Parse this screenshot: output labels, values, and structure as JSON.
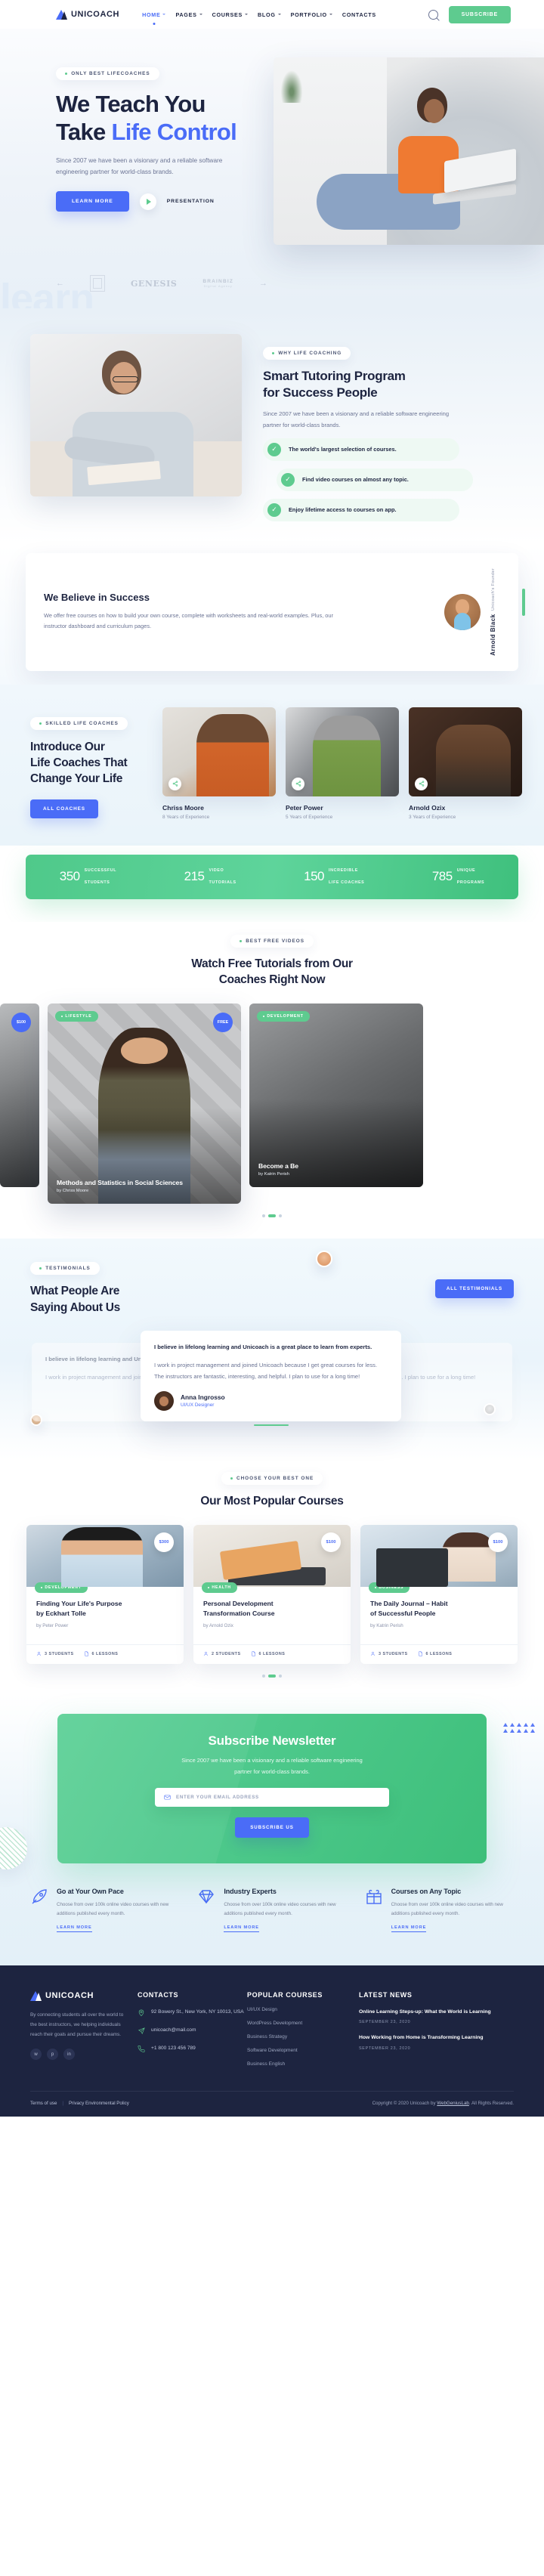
{
  "header": {
    "logo_text": "UNICOACH",
    "nav": [
      {
        "label": "HOME",
        "active": true
      },
      {
        "label": "PAGES",
        "active": false
      },
      {
        "label": "COURSES",
        "active": false
      },
      {
        "label": "BLOG",
        "active": false
      },
      {
        "label": "PORTFOLIO",
        "active": false
      },
      {
        "label": "CONTACTS",
        "active": false
      }
    ],
    "subscribe_label": "SUBSCRIBE"
  },
  "hero": {
    "pill": "ONLY BEST LIFECOACHES",
    "title_line1": "We Teach You",
    "title_line2a": "Take ",
    "title_line2b": "Life Control",
    "subtitle": "Since 2007 we have been a visionary and a reliable software engineering partner for world-class brands.",
    "learn_more": "LEARN MORE",
    "presentation": "PRESENTATION",
    "ghost_word": "learn",
    "brands": {
      "genesis": "GENESIS",
      "brainbiz_name": "BRAINBIZ",
      "brainbiz_sub": "Digital Agency"
    }
  },
  "smart": {
    "pill": "WHY LIFE COACHING",
    "title_line1": "Smart Tutoring Program",
    "title_line2": "for Success People",
    "subtitle": "Since 2007 we have been a visionary and a reliable software engineering partner for world-class brands.",
    "features": [
      "The world's largest selection of courses.",
      "Find video courses on almost any topic.",
      "Enjoy lifetime access to courses on app."
    ]
  },
  "believe": {
    "title": "We Believe in Success",
    "text": "We offer free courses on how to build your own course, complete with worksheets and real-world examples. Plus, our instructor dashboard and curriculum pages.",
    "founder_name": "Arnold Black",
    "founder_role": "Unicoach's Founder"
  },
  "coaches": {
    "pill": "SKILLED LIFE COACHES",
    "title_line1": "Introduce Our",
    "title_line2": "Life Coaches That",
    "title_line3": "Change Your Life",
    "button": "ALL COACHES",
    "cards": [
      {
        "name": "Chriss Moore",
        "experience": "8 Years of Experience"
      },
      {
        "name": "Peter Power",
        "experience": "5 Years of Experience"
      },
      {
        "name": "Arnold Ozix",
        "experience": "3 Years of Experience"
      }
    ]
  },
  "stats": [
    {
      "value": "350",
      "label_line1": "SUCCESSFUL",
      "label_line2": "STUDENTS"
    },
    {
      "value": "215",
      "label_line1": "VIDEO",
      "label_line2": "TUTORIALS"
    },
    {
      "value": "150",
      "label_line1": "INCREDIBLE",
      "label_line2": "LIFE COACHES"
    },
    {
      "value": "785",
      "label_line1": "UNIQUE",
      "label_line2": "PROGRAMS"
    }
  ],
  "videos": {
    "pill": "BEST FREE VIDEOS",
    "title_line1": "Watch Free Tutorials from Our",
    "title_line2": "Coaches Right Now",
    "side_left": {
      "price": "$100"
    },
    "main": {
      "tag": "LIFESTYLE",
      "price": "FREE",
      "title": "Methods and Statistics in Social Sciences",
      "author": "by Chriss Moore"
    },
    "side_right": {
      "tag": "DEVELOPMENT",
      "title": "Become a Be",
      "author": "by Katrin Perish"
    }
  },
  "testimonials": {
    "pill": "TESTIMONIALS",
    "title_line1": "What People Are",
    "title_line2": "Saying About Us",
    "button": "ALL TESTIMONIALS",
    "card": {
      "quote_bold": "I believe in lifelong learning and Unicoach is a great place to learn from experts.",
      "quote": "I work in project management and joined Unicoach because I get great courses for less. The instructors are fantastic, interesting, and helpful. I plan to use for a long time!",
      "author": "Anna Ingrosso",
      "role": "UI/UX Designer"
    }
  },
  "popular": {
    "pill": "CHOOSE YOUR BEST ONE",
    "title": "Our Most Popular Courses",
    "courses": [
      {
        "price": "$300",
        "tag": "DEVELOPMENT",
        "title_line1": "Finding Your Life's Purpose",
        "title_line2": "by Eckhart Tolle",
        "author": "by Peter Power",
        "students": "3 STUDENTS",
        "lessons": "6 LESSONS"
      },
      {
        "price": "$100",
        "tag": "HEALTH",
        "title_line1": "Personal Development",
        "title_line2": "Transformation Course",
        "author": "by Arnold Ozix",
        "students": "2 STUDENTS",
        "lessons": "6 LESSONS"
      },
      {
        "price": "$100",
        "tag": "BUSINESS",
        "title_line1": "The Daily Journal – Habit",
        "title_line2": "of Successful People",
        "author": "by Katrin Perish",
        "students": "3 STUDENTS",
        "lessons": "6 LESSONS"
      }
    ]
  },
  "newsletter": {
    "title": "Subscribe Newsletter",
    "text": "Since 2007 we have been a visionary and a reliable software engineering partner for world-class brands.",
    "placeholder": "ENTER YOUR EMAIL ADDRESS",
    "value": "",
    "button": "SUBSCRIBE US"
  },
  "features": [
    {
      "icon": "rocket-icon",
      "title": "Go at Your Own Pace",
      "text": "Choose from over 100k online video courses with new additions published every month.",
      "link": "LEARN MORE"
    },
    {
      "icon": "diamond-icon",
      "title": "Industry Experts",
      "text": "Choose from over 100k online video courses with new additions published every month.",
      "link": "LEARN MORE"
    },
    {
      "icon": "gift-box-icon",
      "title": "Courses on Any Topic",
      "text": "Choose from over 100k online video courses with new additions published every month.",
      "link": "LEARN MORE"
    }
  ],
  "footer": {
    "logo_text": "UNICOACH",
    "about": "By connecting students all over the world to the best instructors, we helping individuals reach their goals and pursue their dreams.",
    "socials": [
      "twitter-icon",
      "pinterest-icon",
      "linkedin-icon"
    ],
    "contacts": {
      "heading": "CONTACTS",
      "address": "92 Bowery St., New York, NY 10013, USA",
      "email": "unicoach@mail.com",
      "phone": "+1 800 123 456 789"
    },
    "popular_courses": {
      "heading": "POPULAR COURSES",
      "links": [
        "UI/UX Design",
        "WordPress Development",
        "Business Strategy",
        "Software Development",
        "Business English"
      ]
    },
    "latest_news": {
      "heading": "LATEST NEWS",
      "items": [
        {
          "title": "Online Learning Steps-up: What the World is Learning",
          "date": "SEPTEMBER 23, 2020"
        },
        {
          "title": "How Working from Home is Transforming Learning",
          "date": "SEPTEMBER 23, 2020"
        }
      ]
    },
    "bottom": {
      "terms": "Terms of use",
      "separator": "|",
      "privacy": "Privacy Environmental Policy",
      "copyright_pre": "Copyright © 2020 Unicoach by ",
      "copyright_link": "WebGeniusLab",
      "copyright_post": ". All Rights Reserved."
    }
  }
}
